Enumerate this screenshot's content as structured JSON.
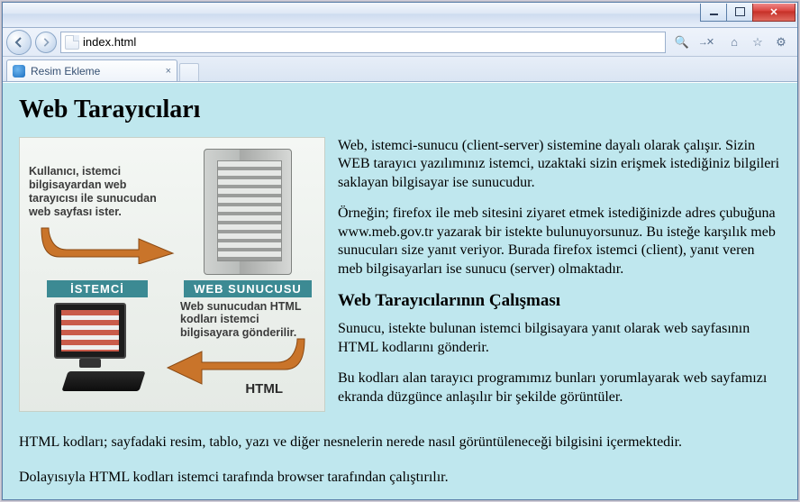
{
  "window": {
    "min_tip": "Minimize",
    "max_tip": "Maximize",
    "close_tip": "Close"
  },
  "nav": {
    "back_tip": "Back",
    "forward_tip": "Forward",
    "address": "index.html",
    "search_glyph": "🔍",
    "refresh_glyph": "→✕",
    "home_glyph": "⌂",
    "star_glyph": "☆",
    "gear_glyph": "⚙"
  },
  "tab": {
    "title": "Resim Ekleme",
    "close_glyph": "×"
  },
  "page": {
    "h1": "Web Tarayıcıları",
    "p1": "Web, istemci-sunucu (client-server) sistemine dayalı olarak çalışır. Sizin WEB tarayıcı yazılımınız istemci, uzaktaki sizin erişmek istediğiniz bilgileri saklayan bilgisayar ise sunucudur.",
    "p2": "Örneğin; firefox ile meb sitesini ziyaret etmek istediğinizde adres çubuğuna www.meb.gov.tr yazarak bir istekte bulunuyorsunuz. Bu isteğe karşılık meb sunucuları size yanıt veriyor. Burada firefox istemci (client), yanıt veren meb bilgisayarları ise sunucu (server) olmaktadır.",
    "h2": "Web Tarayıcılarının Çalışması",
    "p3": "Sunucu, istekte bulunan istemci bilgisayara yanıt olarak web sayfasının HTML kodlarını gönderir.",
    "p4": "Bu kodları alan tarayıcı programımız bunları yorumlayarak web sayfamızı ekranda düzgünce anlaşılır bir şekilde görüntüler.",
    "p5": "HTML kodları; sayfadaki resim, tablo, yazı ve diğer nesnelerin nerede nasıl görüntüleneceği bilgisini içermektedir.",
    "p6": "Dolayısıyla HTML kodları istemci tarafında browser tarafından çalıştırılır."
  },
  "figure": {
    "top_label": "Kullanıcı, istemci bilgisayardan web tarayıcısı ile sunucudan web sayfası ister.",
    "server_caption": "WEB SUNUCUSU",
    "server_sub": "Web sunucudan HTML kodları istemci bilgisayara gönderilir.",
    "client_caption": "İSTEMCİ",
    "html_label": "HTML"
  }
}
